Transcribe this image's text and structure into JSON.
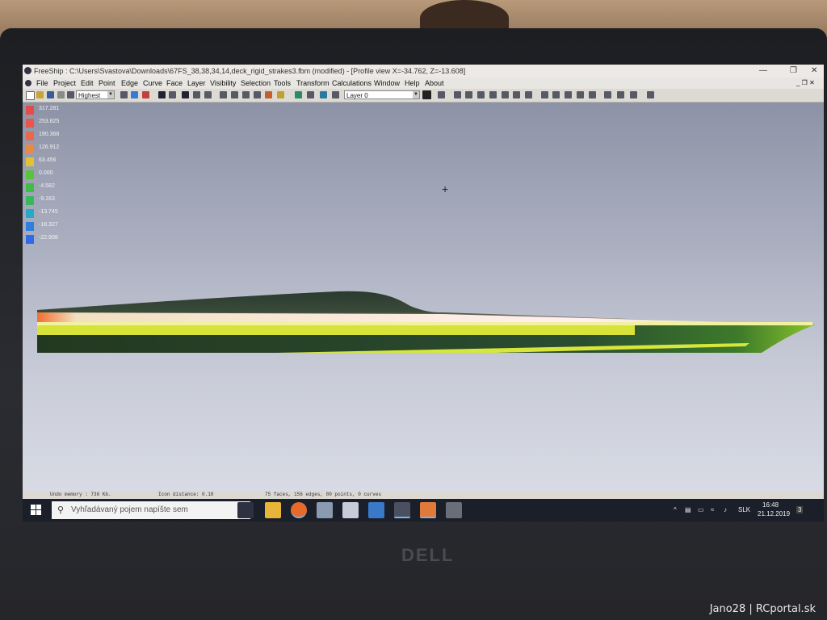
{
  "window": {
    "title": "FreeShip : C:\\Users\\Svastova\\Downloads\\67FS_38,38,34,14,deck_rigid_strakes3.fbm (modified) - [Profile view  X=-34.762,  Z=-13.608]"
  },
  "menu": [
    "File",
    "Project",
    "Edit",
    "Point",
    "Edge",
    "Curve",
    "Face",
    "Layer",
    "Visibility",
    "Selection",
    "Tools",
    "Transform",
    "Calculations",
    "Window",
    "Help",
    "About"
  ],
  "toolbar": {
    "precision_value": "Highest",
    "layer_value": "Layer 0"
  },
  "legend": {
    "values": [
      "317.281",
      "253.825",
      "190.368",
      "126.912",
      "63.456",
      "0.000",
      "-4.582",
      "-9.163",
      "-13.745",
      "-18.327",
      "-22.908"
    ],
    "colors": [
      "#e64b4b",
      "#e8574e",
      "#e6694d",
      "#e88a45",
      "#e0c232",
      "#58c43a",
      "#3fbd44",
      "#36b85c",
      "#2aa8c8",
      "#2f7fe0",
      "#2f6ae8"
    ]
  },
  "status": {
    "undo": "Undo memory : 736 Kb.",
    "distance": "Icon distance: 0.10",
    "counts": "75 faces, 156 edges, 80 points, 0 curves"
  },
  "taskbar": {
    "search_placeholder": "Vyhľadávaný pojem napíšte sem",
    "language": "SLK",
    "time": "16:48",
    "date": "21.12.2019",
    "notifications": "3"
  },
  "bezel_brand": "DELL",
  "caption": "Jano28 | RCportal.sk"
}
